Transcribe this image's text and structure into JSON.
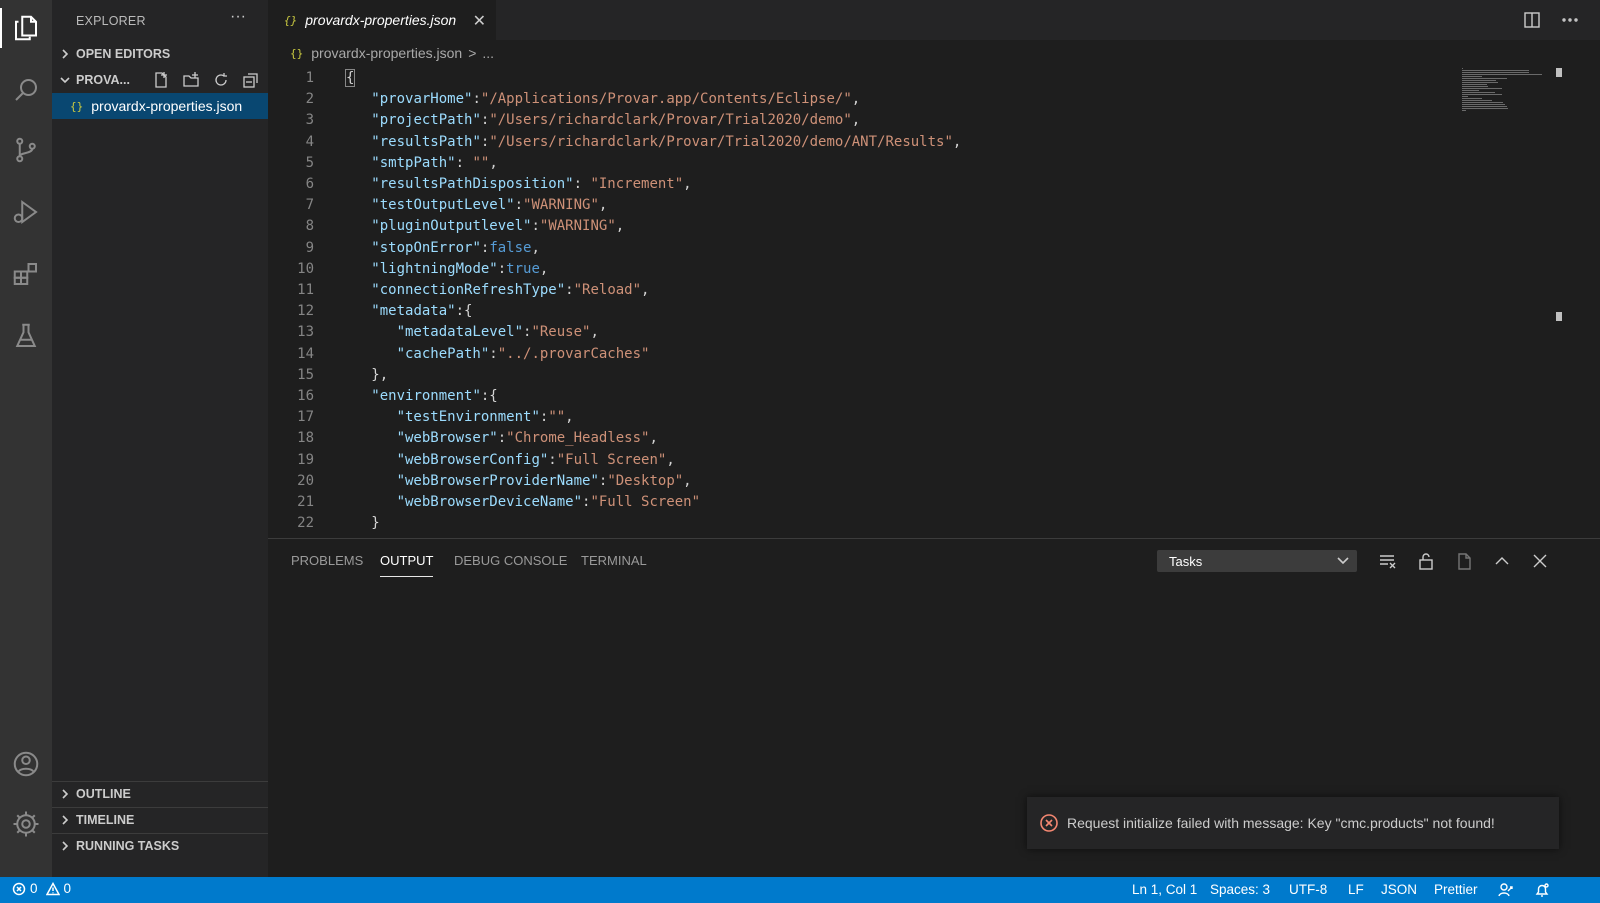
{
  "sidebar": {
    "title": "EXPLORER",
    "more": "···",
    "open_editors": "OPEN EDITORS",
    "folder": "PROVA...",
    "file_icon": "{}",
    "file": "provardx-properties.json",
    "outline": "OUTLINE",
    "timeline": "TIMELINE",
    "running_tasks": "RUNNING TASKS"
  },
  "tab": {
    "icon": "{}",
    "label": "provardx-properties.json",
    "close": "✕"
  },
  "breadcrumb": {
    "icon": "{}",
    "file": "provardx-properties.json",
    "sep": ">",
    "rest": "..."
  },
  "editor": {
    "lines": [
      [
        [
          "p",
          "{"
        ]
      ],
      [
        [
          "p",
          "   "
        ],
        [
          "k",
          "\"provarHome\""
        ],
        [
          "p",
          ":"
        ],
        [
          "s",
          "\"/Applications/Provar.app/Contents/Eclipse/\""
        ],
        [
          "p",
          ","
        ]
      ],
      [
        [
          "p",
          "   "
        ],
        [
          "k",
          "\"projectPath\""
        ],
        [
          "p",
          ":"
        ],
        [
          "s",
          "\"/Users/richardclark/Provar/Trial2020/demo\""
        ],
        [
          "p",
          ","
        ]
      ],
      [
        [
          "p",
          "   "
        ],
        [
          "k",
          "\"resultsPath\""
        ],
        [
          "p",
          ":"
        ],
        [
          "s",
          "\"/Users/richardclark/Provar/Trial2020/demo/ANT/Results\""
        ],
        [
          "p",
          ","
        ]
      ],
      [
        [
          "p",
          "   "
        ],
        [
          "k",
          "\"smtpPath\""
        ],
        [
          "p",
          ": "
        ],
        [
          "s",
          "\"\""
        ],
        [
          "p",
          ","
        ]
      ],
      [
        [
          "p",
          "   "
        ],
        [
          "k",
          "\"resultsPathDisposition\""
        ],
        [
          "p",
          ": "
        ],
        [
          "s",
          "\"Increment\""
        ],
        [
          "p",
          ","
        ]
      ],
      [
        [
          "p",
          "   "
        ],
        [
          "k",
          "\"testOutputLevel\""
        ],
        [
          "p",
          ":"
        ],
        [
          "s",
          "\"WARNING\""
        ],
        [
          "p",
          ","
        ]
      ],
      [
        [
          "p",
          "   "
        ],
        [
          "k",
          "\"pluginOutputlevel\""
        ],
        [
          "p",
          ":"
        ],
        [
          "s",
          "\"WARNING\""
        ],
        [
          "p",
          ","
        ]
      ],
      [
        [
          "p",
          "   "
        ],
        [
          "k",
          "\"stopOnError\""
        ],
        [
          "p",
          ":"
        ],
        [
          "b",
          "false"
        ],
        [
          "p",
          ","
        ]
      ],
      [
        [
          "p",
          "   "
        ],
        [
          "k",
          "\"lightningMode\""
        ],
        [
          "p",
          ":"
        ],
        [
          "b",
          "true"
        ],
        [
          "p",
          ","
        ]
      ],
      [
        [
          "p",
          "   "
        ],
        [
          "k",
          "\"connectionRefreshType\""
        ],
        [
          "p",
          ":"
        ],
        [
          "s",
          "\"Reload\""
        ],
        [
          "p",
          ","
        ]
      ],
      [
        [
          "p",
          "   "
        ],
        [
          "k",
          "\"metadata\""
        ],
        [
          "p",
          ":{"
        ]
      ],
      [
        [
          "p",
          "      "
        ],
        [
          "k",
          "\"metadataLevel\""
        ],
        [
          "p",
          ":"
        ],
        [
          "s",
          "\"Reuse\""
        ],
        [
          "p",
          ","
        ]
      ],
      [
        [
          "p",
          "      "
        ],
        [
          "k",
          "\"cachePath\""
        ],
        [
          "p",
          ":"
        ],
        [
          "s",
          "\"../.provarCaches\""
        ]
      ],
      [
        [
          "p",
          "   },"
        ]
      ],
      [
        [
          "p",
          "   "
        ],
        [
          "k",
          "\"environment\""
        ],
        [
          "p",
          ":{"
        ]
      ],
      [
        [
          "p",
          "      "
        ],
        [
          "k",
          "\"testEnvironment\""
        ],
        [
          "p",
          ":"
        ],
        [
          "s",
          "\"\""
        ],
        [
          "p",
          ","
        ]
      ],
      [
        [
          "p",
          "      "
        ],
        [
          "k",
          "\"webBrowser\""
        ],
        [
          "p",
          ":"
        ],
        [
          "s",
          "\"Chrome_Headless\""
        ],
        [
          "p",
          ","
        ]
      ],
      [
        [
          "p",
          "      "
        ],
        [
          "k",
          "\"webBrowserConfig\""
        ],
        [
          "p",
          ":"
        ],
        [
          "s",
          "\"Full Screen\""
        ],
        [
          "p",
          ","
        ]
      ],
      [
        [
          "p",
          "      "
        ],
        [
          "k",
          "\"webBrowserProviderName\""
        ],
        [
          "p",
          ":"
        ],
        [
          "s",
          "\"Desktop\""
        ],
        [
          "p",
          ","
        ]
      ],
      [
        [
          "p",
          "      "
        ],
        [
          "k",
          "\"webBrowserDeviceName\""
        ],
        [
          "p",
          ":"
        ],
        [
          "s",
          "\"Full Screen\""
        ]
      ],
      [
        [
          "p",
          "   }"
        ]
      ]
    ]
  },
  "panel": {
    "tabs": [
      "PROBLEMS",
      "OUTPUT",
      "DEBUG CONSOLE",
      "TERMINAL"
    ],
    "active_tab": "OUTPUT",
    "select_value": "Tasks"
  },
  "notification": {
    "message": "Request initialize failed with message: Key \"cmc.products\" not found!"
  },
  "statusbar": {
    "errors": "0",
    "warnings": "0",
    "position": "Ln 1, Col 1",
    "spaces": "Spaces: 3",
    "encoding": "UTF-8",
    "eol": "LF",
    "language": "JSON",
    "formatter": "Prettier"
  },
  "colors": {
    "statusbar": "#007acc",
    "activity_bar": "#333333",
    "sidebar": "#252526",
    "editor": "#1e1e1e",
    "selection": "#094771",
    "key": "#9cdcfe",
    "string": "#ce9178",
    "boolean": "#569cd6",
    "error": "#f48771"
  },
  "icons": {
    "activity": [
      "explorer-icon",
      "search-icon",
      "source-control-icon",
      "run-debug-icon",
      "extensions-icon",
      "testing-icon",
      "account-icon",
      "settings-gear-icon"
    ]
  }
}
